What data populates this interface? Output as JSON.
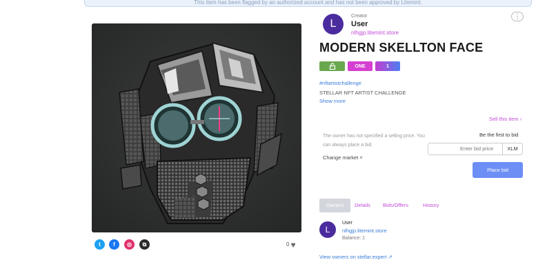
{
  "banner": {
    "text": "This item has been flagged by an authorized account and has not been approved by Litemint."
  },
  "creator": {
    "avatar_letter": "L",
    "label": "Creator",
    "name": "User",
    "link": "nlhgjp.litemint.store"
  },
  "menu": {
    "more_label": "⋮"
  },
  "item": {
    "title": "MODERN SKELLTON FACE",
    "badges": {
      "lock": "🔓",
      "edition": "ONE",
      "count": "1"
    },
    "tag": "#nftartistchallenge",
    "description": "STELLAR NFT ARTIST CHALLENGE",
    "show_more": "Show more"
  },
  "sale": {
    "sell_link": "Sell this item ›",
    "owner_note": "The owner has not specified a selling price. You can always place a bid.",
    "first_bid": "Be the first to bid",
    "bid_placeholder": "Enter bid price",
    "bid_unit": "XLM",
    "change_market": "Change market ˅",
    "place_bid": "Place bid"
  },
  "tabs": [
    {
      "label": "Owners"
    },
    {
      "label": "Details"
    },
    {
      "label": "Bids/Offers"
    },
    {
      "label": "History"
    }
  ],
  "owner": {
    "avatar_letter": "L",
    "name": "User",
    "link": "nlhgjp.litemint.store",
    "balance": "Balance: 1"
  },
  "view_owners": "View owners on stellar.expert ↗",
  "likes": {
    "count": "0"
  },
  "social": [
    {
      "icon": "twitter-icon",
      "glyph": "t",
      "color": "#1da1f2"
    },
    {
      "icon": "facebook-icon",
      "glyph": "f",
      "color": "#1877f2"
    },
    {
      "icon": "instagram-icon",
      "glyph": "◎",
      "color": "#e1306c"
    },
    {
      "icon": "copy-link-icon",
      "glyph": "⧉",
      "color": "#2b2b2b"
    }
  ],
  "colors": {
    "accent_pink": "#c04dd6",
    "link_blue": "#3b7dd8",
    "button_blue": "#6c8ef5",
    "badge_green": "#6aa84f",
    "badge_magenta": "#d63fd1"
  }
}
